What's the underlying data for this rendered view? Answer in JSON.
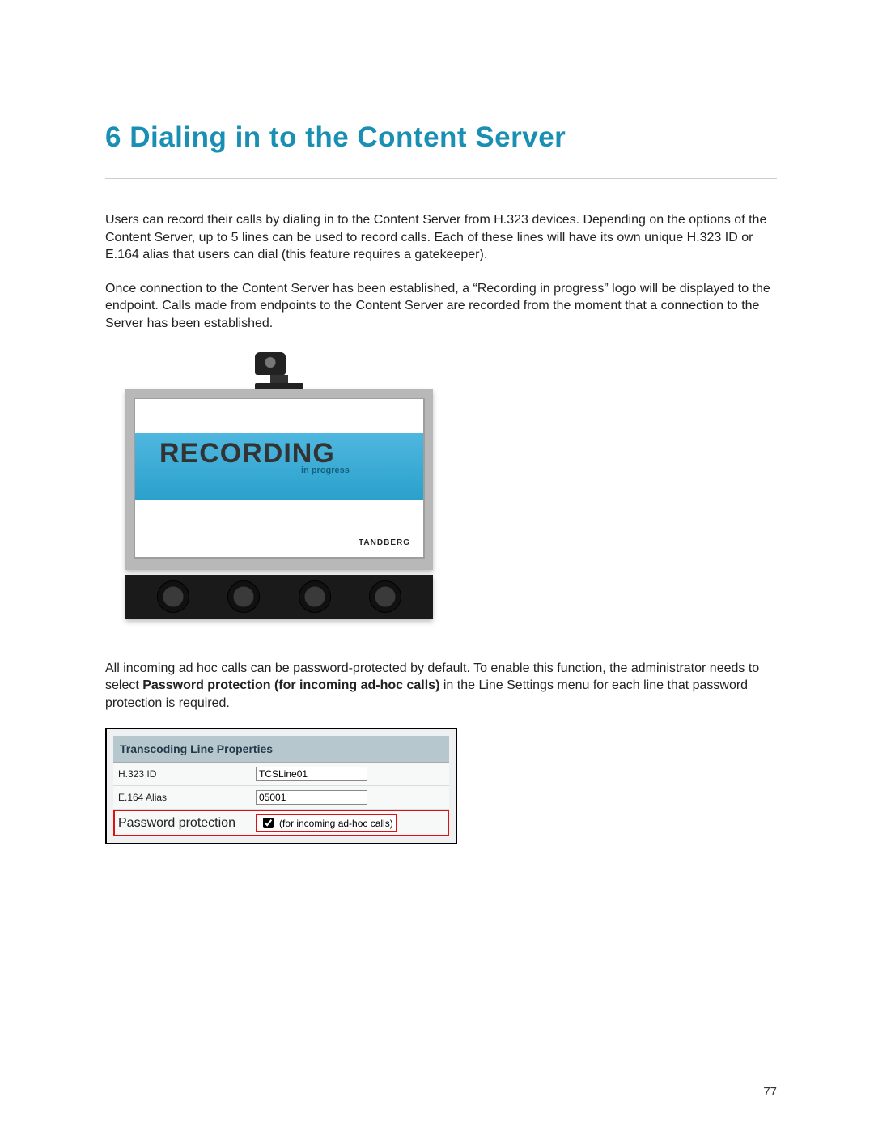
{
  "heading": "6 Dialing in to the Content Server",
  "para1": "Users can record their calls by dialing in to the Content Server from H.323 devices. Depending on the options of the Content Server, up to 5 lines can be used to record calls. Each of these lines will have its own unique H.323 ID or E.164 alias that users can dial (this feature requires a gatekeeper).",
  "para2": "Once connection to the Content Server has been established, a “Recording in progress” logo will be displayed to the endpoint. Calls made from endpoints to the Content Server are recorded from the moment that a connection to the Server has been established.",
  "figure": {
    "recording_label": "RECORDING",
    "recording_sub": "in progress",
    "brand": "TANDBERG"
  },
  "para3_pre": "All incoming ad hoc calls can be password-protected by default. To enable this function, the administrator needs to select ",
  "para3_bold": "Password protection (for incoming ad-hoc calls)",
  "para3_post": " in the Line Settings menu for each line that password protection is required.",
  "panel": {
    "title": "Transcoding Line Properties",
    "rows": {
      "h323_label": "H.323 ID",
      "h323_value": "TCSLine01",
      "e164_label": "E.164 Alias",
      "e164_value": "05001",
      "pw_label": "Password protection",
      "pw_checkbox_label": "(for incoming ad-hoc calls)",
      "pw_checked": true
    }
  },
  "page_number": "77"
}
